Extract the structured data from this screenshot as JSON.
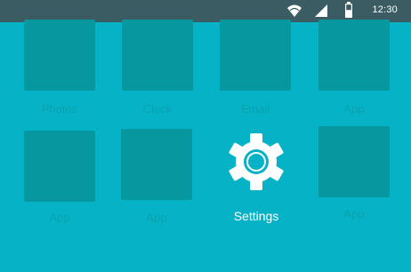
{
  "status_bar": {
    "time": "12:30",
    "icons": [
      "wifi-icon",
      "signal-icon",
      "battery-icon"
    ]
  },
  "home_screen": {
    "row1": [
      {
        "label": "Photos"
      },
      {
        "label": "Clock"
      },
      {
        "label": "Email"
      },
      {
        "label": "App"
      }
    ],
    "row2": [
      {
        "label": "App"
      },
      {
        "label": "App"
      },
      {
        "label": "Settings",
        "icon": "gear-icon",
        "selected": true
      },
      {
        "label": "App"
      }
    ]
  },
  "colors": {
    "background": "#06b3c6",
    "status_bar": "#3b5c62",
    "tile": "#07979f",
    "label_dim": "#0aa1ad",
    "label_active": "#ffffff"
  }
}
